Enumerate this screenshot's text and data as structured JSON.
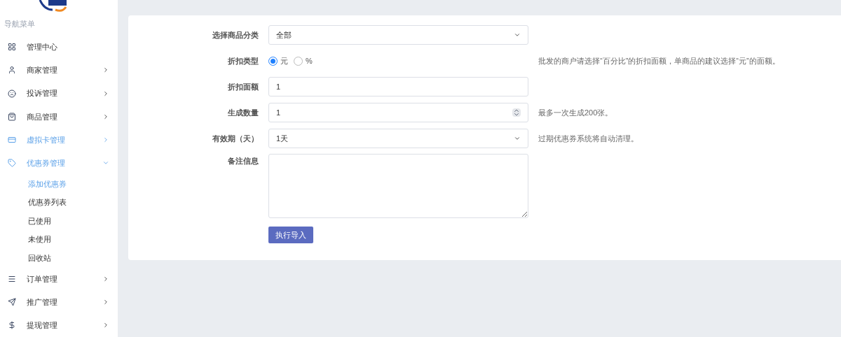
{
  "sidebar": {
    "heading": "导航菜单",
    "items": [
      {
        "label": "管理中心",
        "selected": false,
        "expandable": false,
        "expanded": false
      },
      {
        "label": "商家管理",
        "selected": false,
        "expandable": true,
        "expanded": false
      },
      {
        "label": "投诉管理",
        "selected": false,
        "expandable": true,
        "expanded": false
      },
      {
        "label": "商品管理",
        "selected": false,
        "expandable": true,
        "expanded": false
      },
      {
        "label": "虚拟卡管理",
        "selected": true,
        "expandable": true,
        "expanded": false
      },
      {
        "label": "优惠券管理",
        "selected": true,
        "expandable": true,
        "expanded": true,
        "children": [
          {
            "label": "添加优惠券",
            "selected": true
          },
          {
            "label": "优惠券列表",
            "selected": false
          },
          {
            "label": "已使用",
            "selected": false
          },
          {
            "label": "未使用",
            "selected": false
          },
          {
            "label": "回收站",
            "selected": false
          }
        ]
      },
      {
        "label": "订单管理",
        "selected": false,
        "expandable": true,
        "expanded": false
      },
      {
        "label": "推广管理",
        "selected": false,
        "expandable": true,
        "expanded": false
      },
      {
        "label": "提现管理",
        "selected": false,
        "expandable": true,
        "expanded": false
      }
    ]
  },
  "form": {
    "rows": [
      {
        "kind": "select",
        "label": "选择商品分类",
        "value": "全部"
      },
      {
        "kind": "radio",
        "label": "折扣类型",
        "options": [
          {
            "label": "元",
            "selected": true
          },
          {
            "label": "%",
            "selected": false
          }
        ],
        "hint": "批发的商户请选择“百分比”的折扣面额，单商品的建议选择“元”的面额。"
      },
      {
        "kind": "text",
        "label": "折扣面额",
        "value": "1"
      },
      {
        "kind": "number",
        "label": "生成数量",
        "value": "1",
        "hint": "最多一次生成200张。"
      },
      {
        "kind": "select",
        "label": "有效期（天）",
        "value": "1天",
        "hint": "过期优惠券系统将自动清理。"
      },
      {
        "kind": "textarea",
        "label": "备注信息"
      }
    ],
    "submit": "执行导入"
  }
}
